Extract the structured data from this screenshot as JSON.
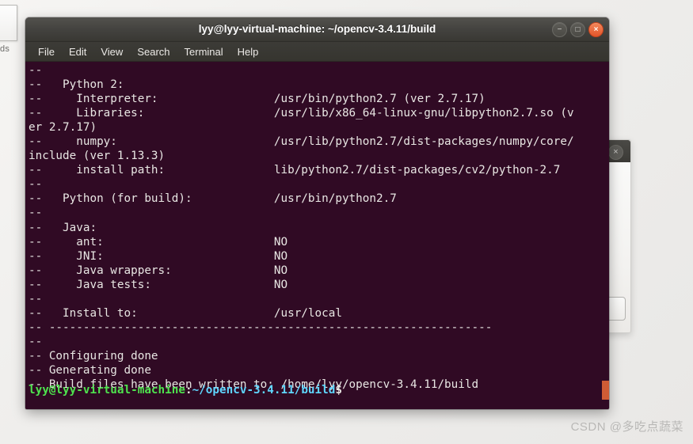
{
  "desktop": {
    "icon_label": "ds",
    "background_window": {
      "close_icon": "×",
      "button_label": ""
    }
  },
  "terminal": {
    "title": "lyy@lyy-virtual-machine: ~/opencv-3.4.11/build",
    "window_controls": [
      {
        "name": "minimize",
        "glyph": "−"
      },
      {
        "name": "maximize",
        "glyph": "□"
      },
      {
        "name": "close",
        "glyph": "×"
      }
    ],
    "menu": [
      {
        "label": "File"
      },
      {
        "label": "Edit"
      },
      {
        "label": "View"
      },
      {
        "label": "Search"
      },
      {
        "label": "Terminal"
      },
      {
        "label": "Help"
      }
    ],
    "colors": {
      "background": "#300a24",
      "foreground": "#e8e6e3",
      "prompt_user": "#4ee44e",
      "prompt_path": "#5fd7ff",
      "cursor": "#cf5c35",
      "titlebar": "#3c3b37",
      "close_button": "#e2542a"
    },
    "output": "--\n--   Python 2:\n--     Interpreter:                 /usr/bin/python2.7 (ver 2.7.17)\n--     Libraries:                   /usr/lib/x86_64-linux-gnu/libpython2.7.so (v\ner 2.7.17)\n--     numpy:                       /usr/lib/python2.7/dist-packages/numpy/core/\ninclude (ver 1.13.3)\n--     install path:                lib/python2.7/dist-packages/cv2/python-2.7\n--\n--   Python (for build):            /usr/bin/python2.7\n--\n--   Java:\n--     ant:                         NO\n--     JNI:                         NO\n--     Java wrappers:               NO\n--     Java tests:                  NO\n--\n--   Install to:                    /usr/local\n-- -----------------------------------------------------------------\n--\n-- Configuring done\n-- Generating done\n-- Build files have been written to: /home/lyy/opencv-3.4.11/build",
    "prompt": {
      "user_host": "lyy@lyy-virtual-machine",
      "colon": ":",
      "path": "~/opencv-3.4.11/build",
      "symbol": "$"
    }
  },
  "watermark": "CSDN @多吃点蔬菜"
}
